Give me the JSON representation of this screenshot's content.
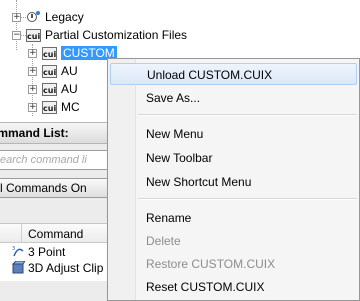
{
  "tree": {
    "legacy": "Legacy",
    "partial": "Partial Customization Files",
    "custom": "CUSTOM",
    "child2": "AU",
    "child3": "AU",
    "child4": "MC",
    "icon_text": "cui"
  },
  "panel": {
    "command_list_label": "ommand List:",
    "search_placeholder": "earch command li",
    "filter_value": "l Commands On",
    "column_command": "Command",
    "rows": [
      "3 Point",
      "3D Adjust Clip"
    ]
  },
  "context_menu": {
    "items": [
      {
        "label": "Unload CUSTOM.CUIX",
        "enabled": true
      },
      {
        "label": "Save As...",
        "enabled": true
      },
      {
        "label": "New Menu",
        "enabled": true
      },
      {
        "label": "New Toolbar",
        "enabled": true
      },
      {
        "label": "New Shortcut Menu",
        "enabled": true
      },
      {
        "label": "Rename",
        "enabled": true
      },
      {
        "label": "Delete",
        "enabled": false
      },
      {
        "label": "Restore CUSTOM.CUIX",
        "enabled": false
      },
      {
        "label": "Reset CUSTOM.CUIX",
        "enabled": true
      }
    ]
  },
  "colors": {
    "selection": "#3399ff",
    "menu_hover": "#dce8f8",
    "disabled_text": "#8d8d8d"
  }
}
